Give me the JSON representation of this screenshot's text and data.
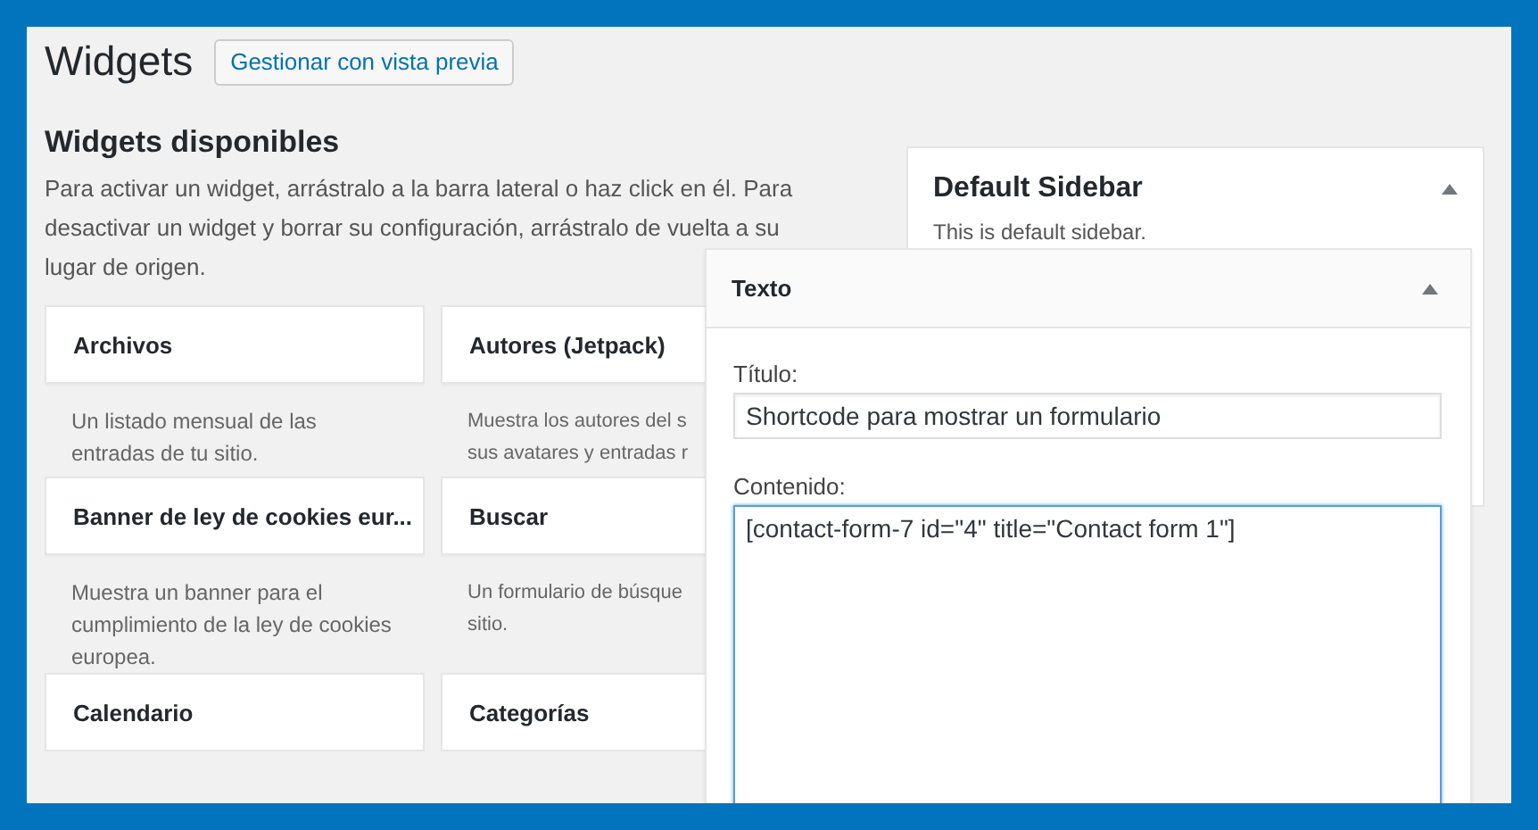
{
  "page": {
    "title": "Widgets",
    "preview_button": "Gestionar con vista previa"
  },
  "available": {
    "heading": "Widgets disponibles",
    "description": "Para activar un widget, arrástralo a la barra lateral o haz click en él. Para desactivar un widget y borrar su configuración, arrástralo de vuelta a su lugar de origen.",
    "widgets": [
      {
        "title": "Archivos",
        "description_lines": [
          "Un listado mensual de las",
          "entradas de tu sitio."
        ]
      },
      {
        "title": "Autores (Jetpack)",
        "description_lines": [
          "Muestra los autores del s",
          "sus avatares y entradas r"
        ]
      },
      {
        "title": "Banner de ley de cookies eur...",
        "description_lines": [
          "Muestra un banner para el",
          "cumplimiento de la ley de cookies",
          "europea."
        ]
      },
      {
        "title": "Buscar",
        "description_lines": [
          "Un formulario de búsque",
          "sitio."
        ]
      },
      {
        "title": "Calendario"
      },
      {
        "title": "Categorías"
      }
    ]
  },
  "sidebar": {
    "title": "Default Sidebar",
    "description": "This is default sidebar.",
    "expanded": true
  },
  "widget_panel": {
    "title": "Texto",
    "expanded": true,
    "fields": [
      {
        "kind": "input",
        "label": "Título:",
        "value": "Shortcode para mostrar un formulario"
      },
      {
        "kind": "textarea",
        "label": "Contenido:",
        "value": "[contact-form-7 id=\"4\" title=\"Contact form 1\"]"
      }
    ]
  }
}
